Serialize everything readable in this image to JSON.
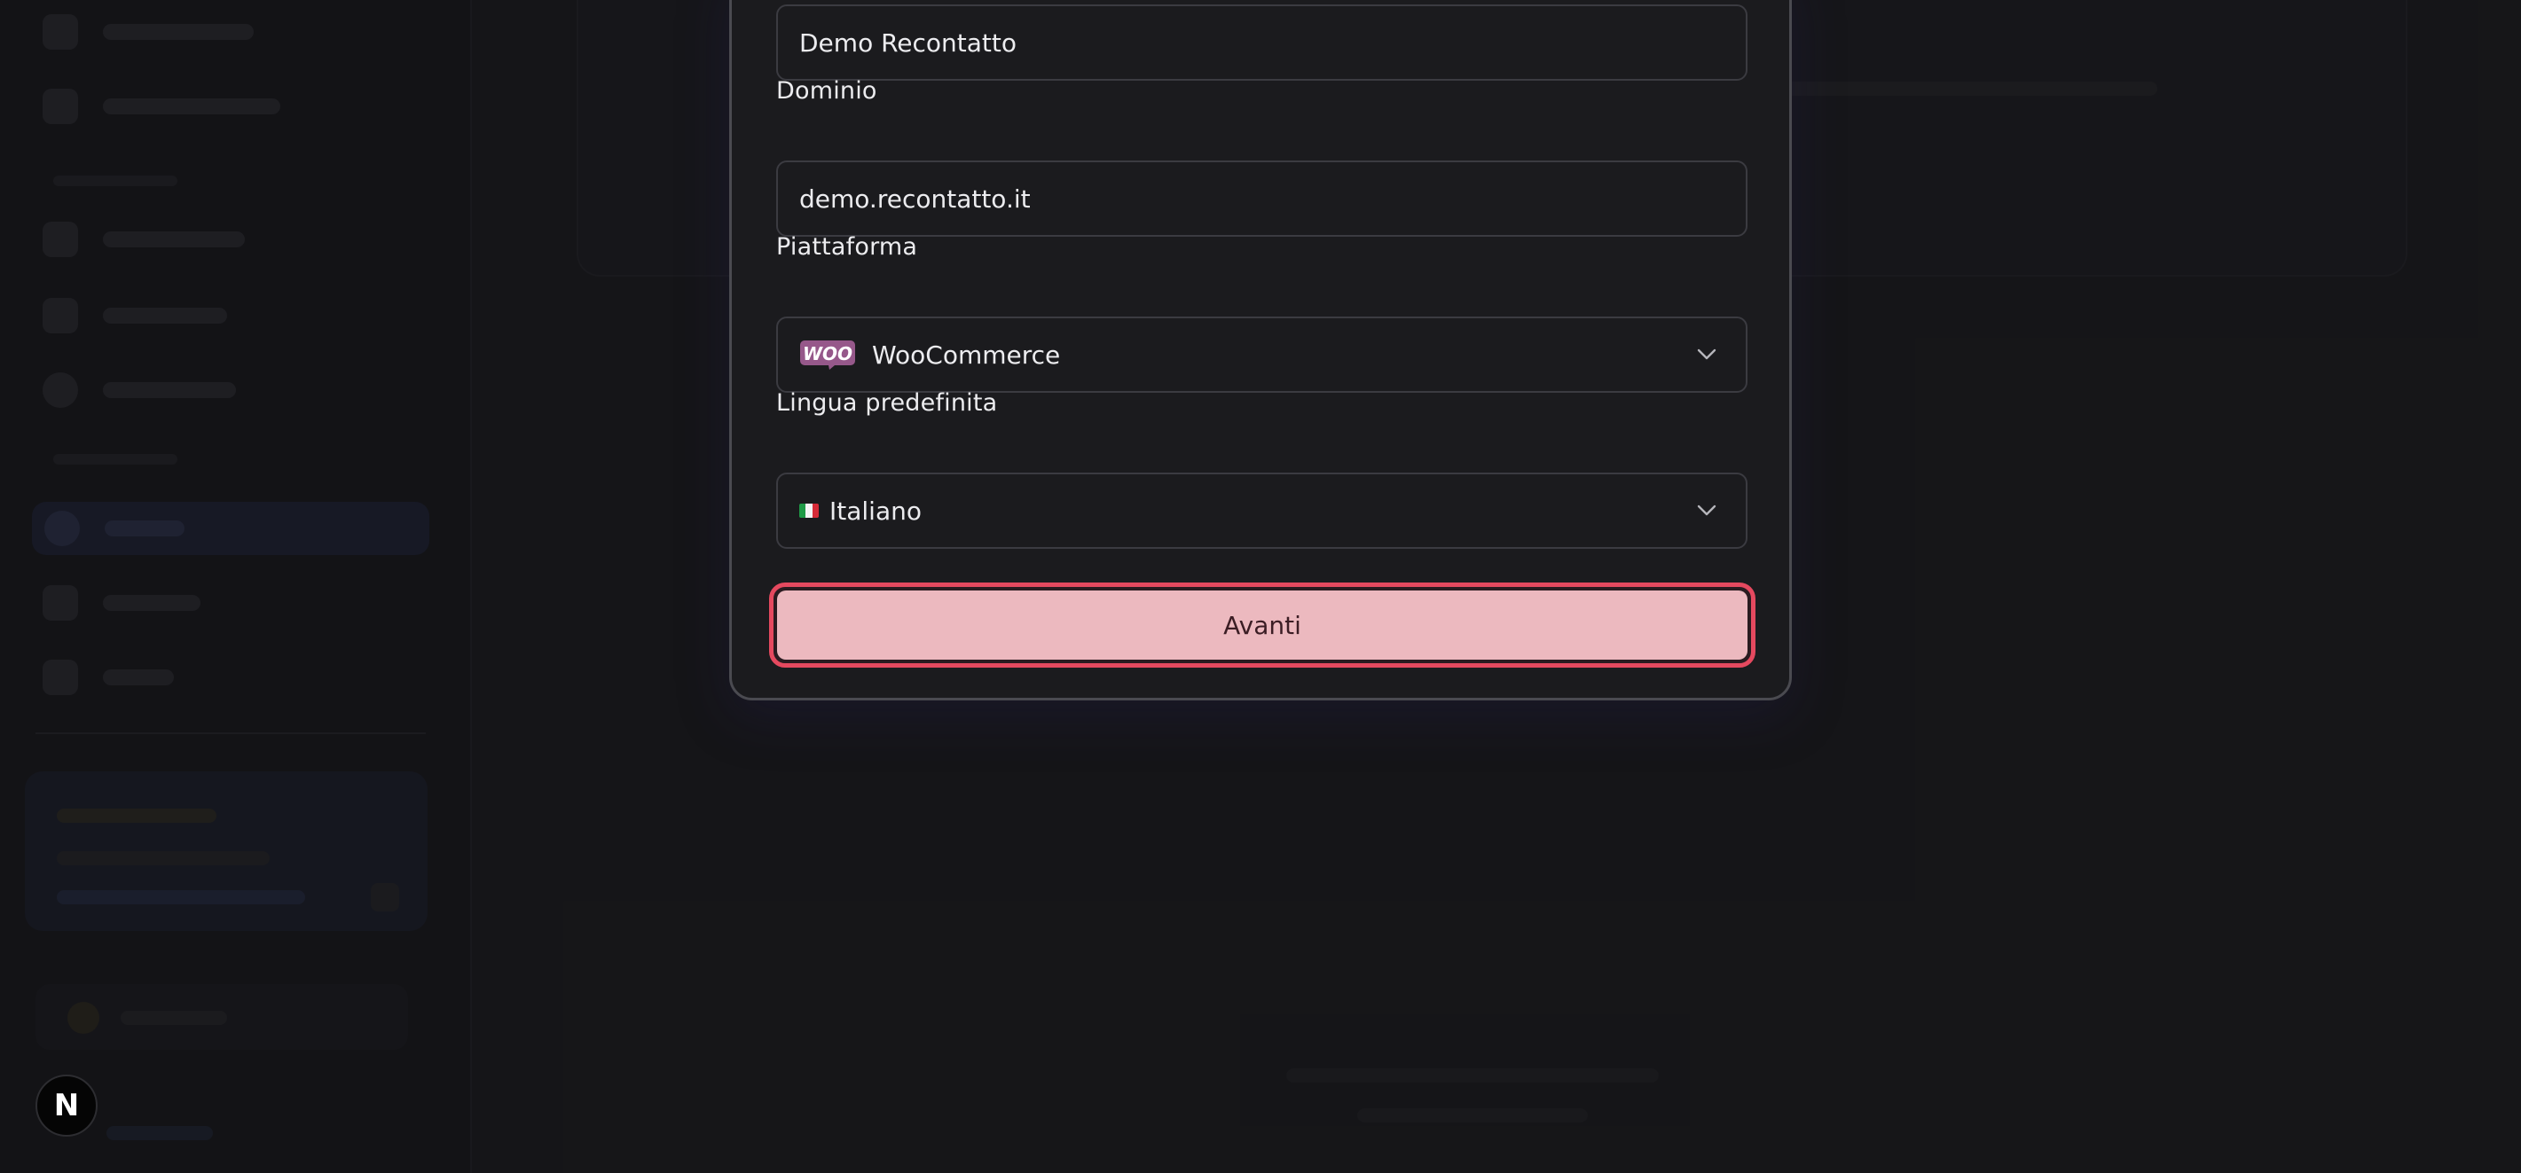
{
  "form": {
    "name": {
      "value": "Demo Recontatto"
    },
    "domain": {
      "label": "Dominio",
      "value": "demo.recontatto.it"
    },
    "platform": {
      "label": "Piattaforma",
      "value": "WooCommerce",
      "logo_text": "WOO",
      "logo_icon": "woocommerce-logo-icon"
    },
    "language": {
      "label": "Lingua predefinita",
      "value": "Italiano",
      "flag_icon": "italy-flag-icon"
    },
    "submit": {
      "label": "Avanti"
    }
  },
  "dev_badge": {
    "letter": "N",
    "icon": "nextjs-icon"
  },
  "colors": {
    "accent_border": "#e5495f",
    "button_bg": "#ecb9bf",
    "woo_purple": "#96588a"
  }
}
